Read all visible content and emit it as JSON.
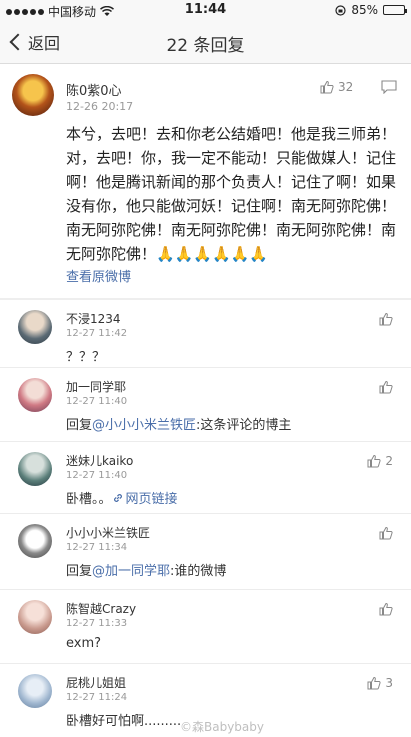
{
  "status_bar": {
    "carrier": "中国移动",
    "time": "11:44",
    "battery": "85%",
    "battery_level": 0.85
  },
  "nav": {
    "back_label": "返回",
    "title": "22 条回复"
  },
  "post": {
    "username": "陈0紫0心",
    "time": "12-26 20:17",
    "likes": "32",
    "text": "本兮，去吧！去和你老公结婚吧！他是我三师弟！对，去吧！你，我一定不能动！只能做媒人！记住啊！他是腾讯新闻的那个负责人！记住了啊！如果没有你，他只能做河妖！记住啊！南无阿弥陀佛！南无阿弥陀佛！南无阿弥陀佛！南无阿弥陀佛！南无阿弥陀佛！🙏🙏🙏🙏🙏🙏",
    "link_label": "查看原微博"
  },
  "comments": [
    {
      "username": "不浸1234",
      "time": "12-27 11:42",
      "text": "？？？",
      "likes": ""
    },
    {
      "username": "加一同学耶",
      "time": "12-27 11:40",
      "reply_prefix": "回复",
      "mention": "@小小小米兰铁匠",
      "text": ":这条评论的博主",
      "likes": ""
    },
    {
      "username": "迷妹儿kaiko",
      "time": "12-27 11:40",
      "text": "卧槽。。",
      "link_label": "网页链接",
      "likes": "2"
    },
    {
      "username": "小小小米兰铁匠",
      "time": "12-27 11:34",
      "reply_prefix": "回复",
      "mention": "@加一同学耶",
      "text": ":谁的微博",
      "likes": ""
    },
    {
      "username": "陈智越Crazy",
      "time": "12-27 11:33",
      "text": "exm?",
      "likes": ""
    },
    {
      "username": "屁桃儿姐姐",
      "time": "12-27 11:24",
      "text": "卧槽好可怕啊.........",
      "likes": "3"
    }
  ],
  "watermark": "©森Babybaby",
  "colors": {
    "link": "#4a6ea9",
    "meta": "#999999",
    "background": "#ffffff"
  }
}
